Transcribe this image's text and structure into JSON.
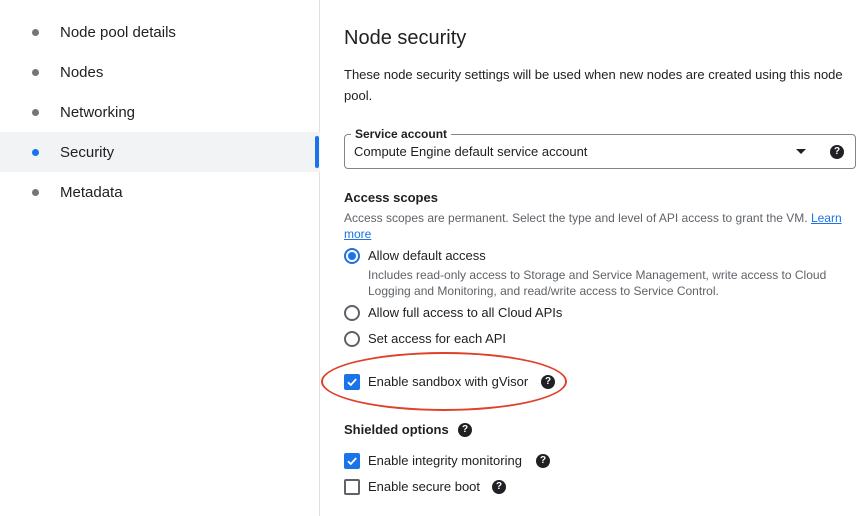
{
  "sidebar": {
    "items": [
      {
        "label": "Node pool details",
        "active": false
      },
      {
        "label": "Nodes",
        "active": false
      },
      {
        "label": "Networking",
        "active": false
      },
      {
        "label": "Security",
        "active": true
      },
      {
        "label": "Metadata",
        "active": false
      }
    ]
  },
  "main": {
    "title": "Node security",
    "description": "These node security settings will be used when new nodes are created using this node pool.",
    "service_account": {
      "label": "Service account",
      "value": "Compute Engine default service account"
    },
    "access_scopes": {
      "label": "Access scopes",
      "description": "Access scopes are permanent. Select the type and level of API access to grant the VM.",
      "learn_more": "Learn more",
      "options": [
        {
          "label": "Allow default access",
          "description": "Includes read-only access to Storage and Service Management, write access to Cloud Logging and Monitoring, and read/write access to Service Control.",
          "selected": true
        },
        {
          "label": "Allow full access to all Cloud APIs",
          "selected": false
        },
        {
          "label": "Set access for each API",
          "selected": false
        }
      ]
    },
    "sandbox": {
      "label": "Enable sandbox with gVisor",
      "checked": true
    },
    "shielded": {
      "label": "Shielded options",
      "integrity": {
        "label": "Enable integrity monitoring",
        "checked": true
      },
      "secure_boot": {
        "label": "Enable secure boot",
        "checked": false
      }
    }
  },
  "colors": {
    "accent": "#1a73e8",
    "annotation": "#e0402a"
  },
  "icons": {
    "help": "?"
  }
}
